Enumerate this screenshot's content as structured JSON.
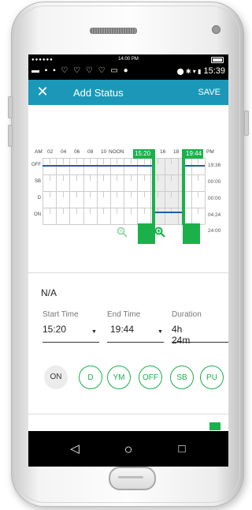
{
  "ios_status": {
    "dots": "●●●●●●",
    "time": "14:00 PM"
  },
  "android_status": {
    "icons_left": "▬ ▪ ▪ ♡ ♡ ♡ ♡ ▭ ●",
    "icons_right": "⬤ ✱ ▾ ▮",
    "time": "15:39"
  },
  "app_bar": {
    "close": "✕",
    "title": "Add Status",
    "save": "SAVE"
  },
  "chart": {
    "hour_ticks": [
      "AM",
      "02",
      "04",
      "06",
      "08",
      "10",
      "NOON",
      "16",
      "18",
      "PM"
    ],
    "row_labels": [
      "OFF",
      "SB",
      "D",
      "ON"
    ],
    "totals": [
      "19:36",
      "00:00",
      "00:00",
      "04:24",
      "24:00"
    ],
    "start_flag": "15:20",
    "end_flag": "19:44",
    "accent": "#1bb04a",
    "line_color": "#1f5fa6"
  },
  "zoom": {
    "out_icon": "zoom-out-icon",
    "in_icon": "zoom-in-icon"
  },
  "status_text": "N/A",
  "start_time": {
    "label": "Start Time",
    "value": "15:20"
  },
  "end_time": {
    "label": "End Time",
    "value": "19:44"
  },
  "duration": {
    "label": "Duration",
    "value": "4h 24m"
  },
  "status_buttons": [
    "ON",
    "D",
    "YM",
    "OFF",
    "SB",
    "PU"
  ],
  "nav": {
    "back": "◁",
    "home": "○",
    "recent": "□"
  },
  "colors": {
    "app_bar": "#1b98b8",
    "accent": "#1bb04a"
  }
}
